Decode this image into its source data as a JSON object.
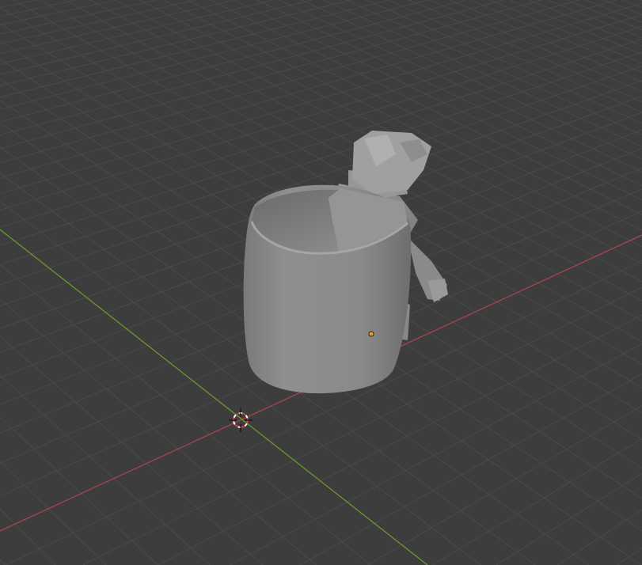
{
  "viewport": {
    "name": "3D Viewport",
    "colors": {
      "background": "#3d3d3d",
      "grid": "#4a4a4a",
      "x_axis": "#a8444e",
      "y_axis": "#6a9a2a",
      "object_origin": "#f0a020",
      "mesh": "#8c8c8c"
    },
    "icons": [
      "3d-cursor-icon",
      "object-origin-icon"
    ]
  }
}
